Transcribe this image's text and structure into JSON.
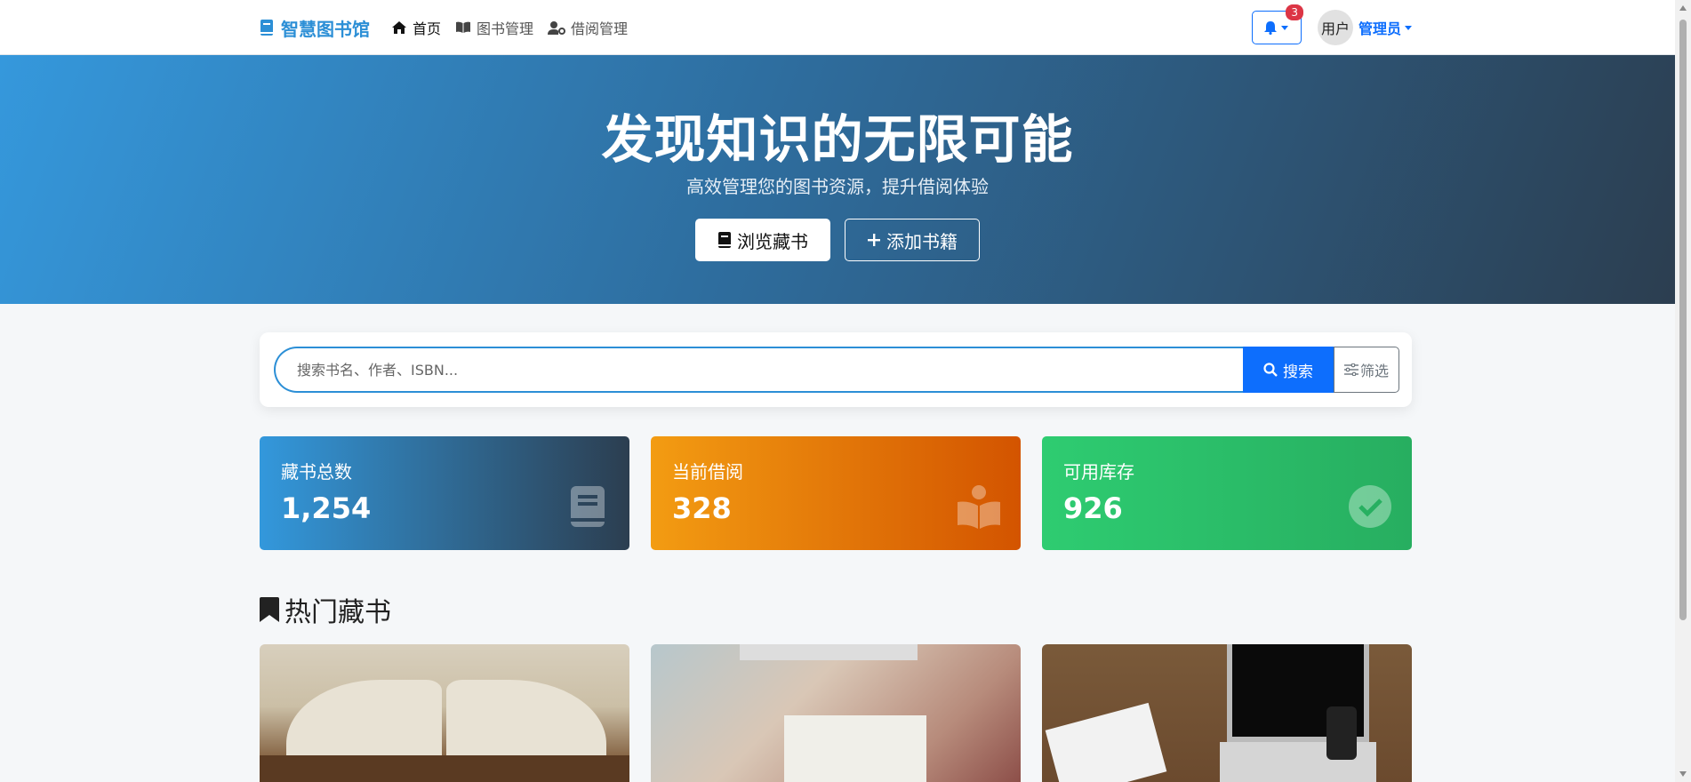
{
  "navbar": {
    "brand": "智慧图书馆",
    "links": [
      {
        "label": "首页",
        "icon": "home-icon",
        "active": true
      },
      {
        "label": "图书管理",
        "icon": "book-open-icon",
        "active": false
      },
      {
        "label": "借阅管理",
        "icon": "user-gear-icon",
        "active": false
      }
    ],
    "notification_count": "3",
    "avatar_text": "用户",
    "user_label": "管理员"
  },
  "hero": {
    "title": "发现知识的无限可能",
    "subtitle": "高效管理您的图书资源，提升借阅体验",
    "browse_label": "浏览藏书",
    "add_label": "添加书籍"
  },
  "search": {
    "placeholder": "搜索书名、作者、ISBN...",
    "value": "",
    "search_label": "搜索",
    "filter_label": "筛选"
  },
  "stats": [
    {
      "label": "藏书总数",
      "value": "1,254",
      "icon": "book-icon"
    },
    {
      "label": "当前借阅",
      "value": "328",
      "icon": "book-reader-icon"
    },
    {
      "label": "可用库存",
      "value": "926",
      "icon": "check-circle-icon"
    }
  ],
  "section": {
    "title": "热门藏书"
  },
  "colors": {
    "brand": "#2c8fd6",
    "primary": "#0d6efd",
    "danger": "#dc3545"
  }
}
